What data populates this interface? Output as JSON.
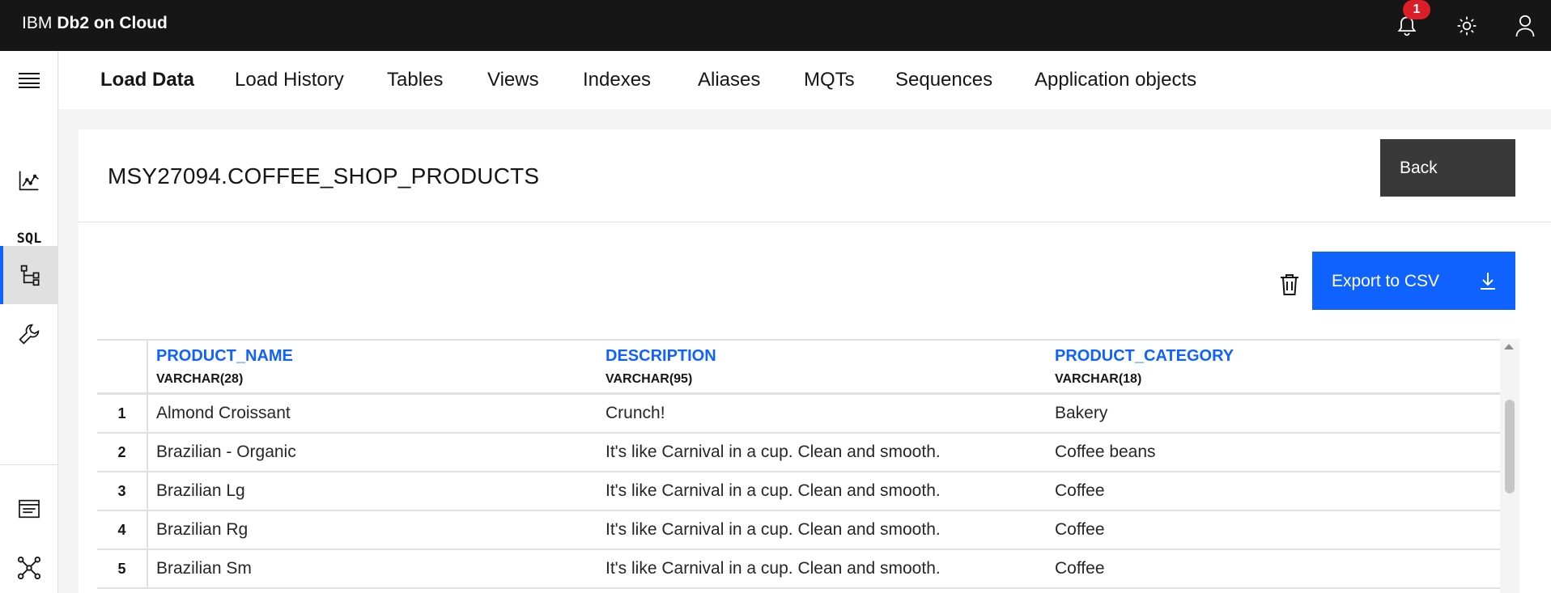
{
  "header": {
    "brand_prefix": "IBM",
    "brand_product": "Db2 on Cloud",
    "notification_count": "1",
    "icons": [
      "notification-icon",
      "theme-icon",
      "user-icon"
    ]
  },
  "rail": {
    "items": [
      "menu-icon",
      "monitor-chart-icon",
      "sql-icon",
      "data-tree-icon",
      "wrench-icon",
      "document-list-icon",
      "network-icon"
    ],
    "sql_label": "SQL",
    "active": "data-tree-icon"
  },
  "tabs": [
    {
      "label": "Load Data",
      "active": true
    },
    {
      "label": "Load History"
    },
    {
      "label": "Tables"
    },
    {
      "label": "Views"
    },
    {
      "label": "Indexes"
    },
    {
      "label": "Aliases"
    },
    {
      "label": "MQTs"
    },
    {
      "label": "Sequences"
    },
    {
      "label": "Application objects"
    }
  ],
  "card": {
    "table_name": "MSY27094.COFFEE_SHOP_PRODUCTS",
    "back_label": "Back",
    "export_label": "Export to CSV"
  },
  "grid": {
    "columns": [
      {
        "name": "PRODUCT_NAME",
        "type": "VARCHAR(28)"
      },
      {
        "name": "DESCRIPTION",
        "type": "VARCHAR(95)"
      },
      {
        "name": "PRODUCT_CATEGORY",
        "type": "VARCHAR(18)"
      }
    ],
    "rows": [
      {
        "num": "1",
        "cells": [
          "Almond Croissant",
          "Crunch!",
          "Bakery"
        ]
      },
      {
        "num": "2",
        "cells": [
          "Brazilian - Organic",
          "It's like Carnival in a cup. Clean and smooth.",
          "Coffee beans"
        ]
      },
      {
        "num": "3",
        "cells": [
          "Brazilian Lg",
          "It's like Carnival in a cup. Clean and smooth.",
          "Coffee"
        ]
      },
      {
        "num": "4",
        "cells": [
          "Brazilian Rg",
          "It's like Carnival in a cup. Clean and smooth.",
          "Coffee"
        ]
      },
      {
        "num": "5",
        "cells": [
          "Brazilian Sm",
          "It's like Carnival in a cup. Clean and smooth.",
          "Coffee"
        ]
      }
    ]
  },
  "colors": {
    "accent": "#0f62fe",
    "header_bg": "#161616",
    "back_bg": "#393939",
    "badge": "#da1e28"
  }
}
